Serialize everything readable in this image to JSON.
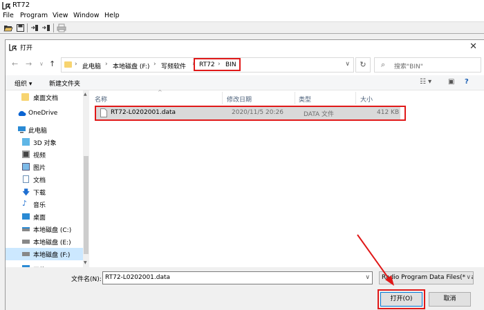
{
  "app": {
    "title": "RT72",
    "menu": [
      "File",
      "Program",
      "View",
      "Window",
      "Help"
    ]
  },
  "dialog": {
    "title": "打开",
    "breadcrumb": [
      "此电脑",
      "本地磁盘 (F:)",
      "写频软件",
      "RT72",
      "BIN"
    ],
    "search_placeholder": "搜索\"BIN\"",
    "organize": "组织 ▾",
    "new_folder": "新建文件夹",
    "nav": [
      {
        "label": "桌面文档",
        "icon": "folder-icon"
      },
      {
        "label": "OneDrive",
        "icon": "cloud-icon"
      },
      {
        "label": "此电脑",
        "icon": "computer-icon"
      },
      {
        "label": "3D 对象",
        "icon": "cube-icon"
      },
      {
        "label": "视频",
        "icon": "video-icon"
      },
      {
        "label": "图片",
        "icon": "picture-icon"
      },
      {
        "label": "文档",
        "icon": "document-icon"
      },
      {
        "label": "下载",
        "icon": "download-icon"
      },
      {
        "label": "音乐",
        "icon": "music-icon"
      },
      {
        "label": "桌面",
        "icon": "desktop-icon"
      },
      {
        "label": "本地磁盘 (C:)",
        "icon": "drive-icon"
      },
      {
        "label": "本地磁盘 (E:)",
        "icon": "drive-icon"
      },
      {
        "label": "本地磁盘 (F:)",
        "icon": "drive-icon"
      },
      {
        "label": "网络",
        "icon": "network-icon"
      }
    ],
    "columns": [
      "名称",
      "修改日期",
      "类型",
      "大小"
    ],
    "files": [
      {
        "name": "RT72-L0202001.data",
        "modified": "2020/11/5 20:26",
        "type": "DATA 文件",
        "size": "412 KB"
      }
    ],
    "filename_label": "文件名(N):",
    "filename_value": "RT72-L0202001.data",
    "filter_value": "Radio Program Data Files(*.data)",
    "open_button": "打开(O)",
    "cancel_button": "取消"
  },
  "colors": {
    "highlight": "#e01818",
    "selection": "#cce8ff",
    "accent": "#0078d7"
  }
}
